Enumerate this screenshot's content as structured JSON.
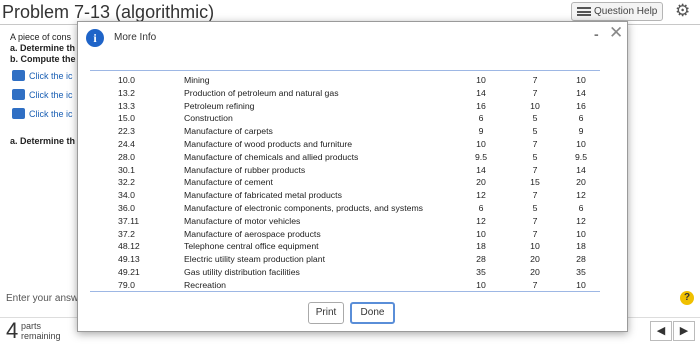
{
  "background": {
    "title": "Problem 7-13 (algorithmic)",
    "question_help": "Question Help",
    "question_lines": [
      "A piece of cons",
      "a. Determine th",
      "b. Compute the"
    ],
    "links": [
      "Click the ic",
      "Click the ic",
      "Click the ic"
    ],
    "part_a": "a. Determine th",
    "enter_answer": "Enter your answ",
    "help_symbol": "?",
    "parts_count": "4",
    "parts_label_line1": "parts",
    "parts_label_line2": "remaining",
    "nav_prev": "◀",
    "nav_next": "▶"
  },
  "modal": {
    "title": "More Info",
    "info_symbol": "i",
    "minimize_symbol": "-",
    "close_symbol": "✕",
    "rows": [
      {
        "sic": "10.0",
        "industry": "Mining",
        "a": "10",
        "b": "7",
        "c": "10"
      },
      {
        "sic": "13.2",
        "industry": "Production of petroleum and natural gas",
        "a": "14",
        "b": "7",
        "c": "14"
      },
      {
        "sic": "13.3",
        "industry": "Petroleum refining",
        "a": "16",
        "b": "10",
        "c": "16"
      },
      {
        "sic": "15.0",
        "industry": "Construction",
        "a": "6",
        "b": "5",
        "c": "6"
      },
      {
        "sic": "22.3",
        "industry": "Manufacture of carpets",
        "a": "9",
        "b": "5",
        "c": "9"
      },
      {
        "sic": "24.4",
        "industry": "Manufacture of wood products and furniture",
        "a": "10",
        "b": "7",
        "c": "10"
      },
      {
        "sic": "28.0",
        "industry": "Manufacture of chemicals and allied products",
        "a": "9.5",
        "b": "5",
        "c": "9.5"
      },
      {
        "sic": "30.1",
        "industry": "Manufacture of rubber products",
        "a": "14",
        "b": "7",
        "c": "14"
      },
      {
        "sic": "32.2",
        "industry": "Manufacture of cement",
        "a": "20",
        "b": "15",
        "c": "20"
      },
      {
        "sic": "34.0",
        "industry": "Manufacture of fabricated metal products",
        "a": "12",
        "b": "7",
        "c": "12"
      },
      {
        "sic": "36.0",
        "industry": "Manufacture of electronic components, products, and systems",
        "a": "6",
        "b": "5",
        "c": "6"
      },
      {
        "sic": "37.11",
        "industry": "Manufacture of motor vehicles",
        "a": "12",
        "b": "7",
        "c": "12"
      },
      {
        "sic": "37.2",
        "industry": "Manufacture of aerospace products",
        "a": "10",
        "b": "7",
        "c": "10"
      },
      {
        "sic": "48.12",
        "industry": "Telephone central office equipment",
        "a": "18",
        "b": "10",
        "c": "18"
      },
      {
        "sic": "49.13",
        "industry": "Electric utility steam production plant",
        "a": "28",
        "b": "20",
        "c": "28"
      },
      {
        "sic": "49.21",
        "industry": "Gas utility distribution facilities",
        "a": "35",
        "b": "20",
        "c": "35"
      },
      {
        "sic": "79.0",
        "industry": "Recreation",
        "a": "10",
        "b": "7",
        "c": "10"
      }
    ],
    "print_label": "Print",
    "done_label": "Done"
  }
}
